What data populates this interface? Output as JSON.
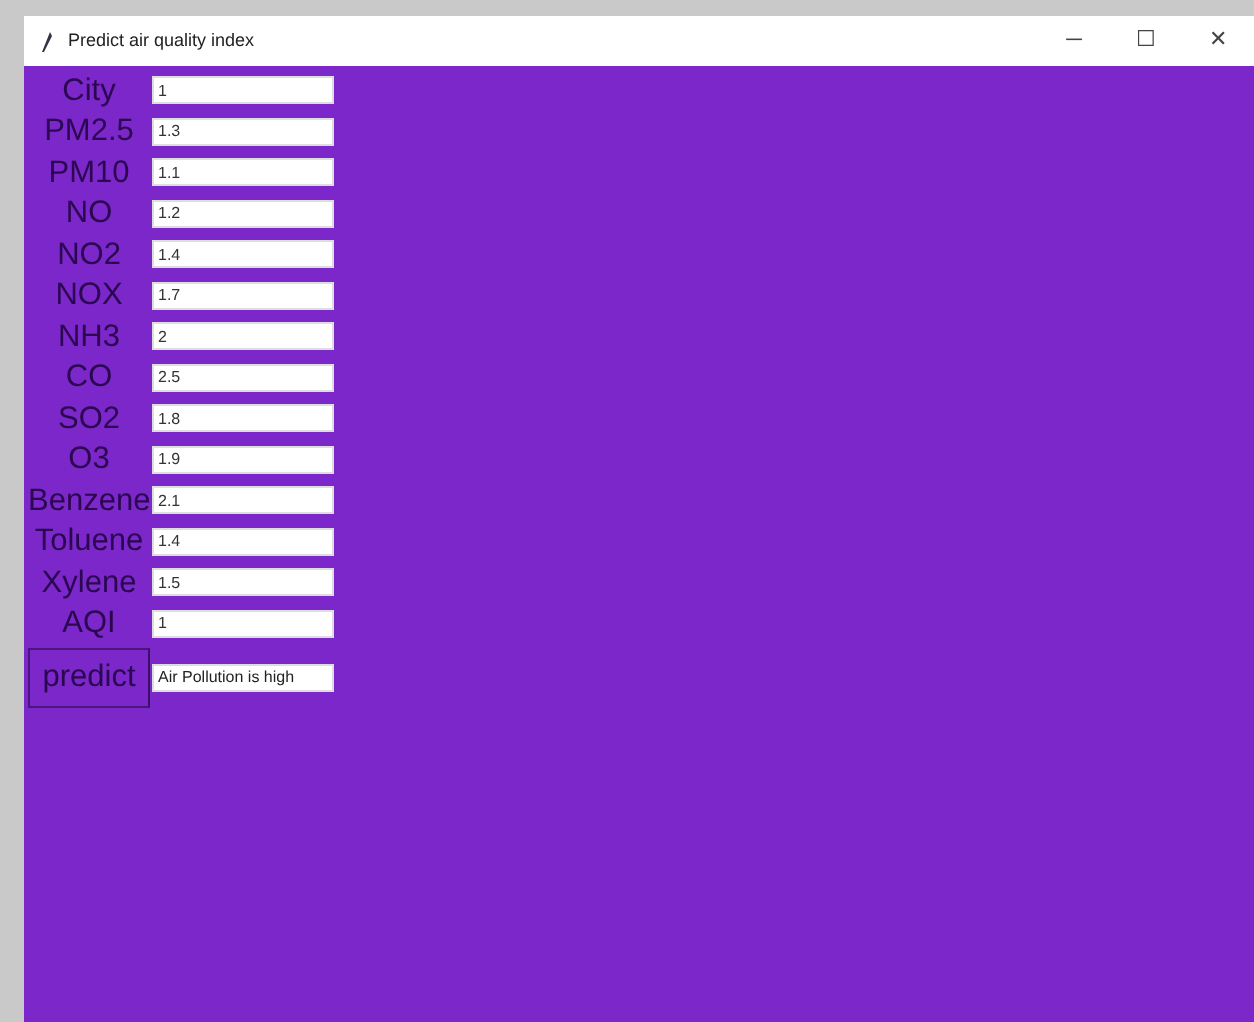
{
  "window": {
    "title": "Predict air quality index",
    "controls": [
      "─",
      "☐",
      "✕"
    ]
  },
  "fields": [
    {
      "label": "City",
      "value": "1"
    },
    {
      "label": "PM2.5",
      "value": "1.3"
    },
    {
      "label": "PM10",
      "value": "1.1"
    },
    {
      "label": "NO",
      "value": "1.2"
    },
    {
      "label": "NO2",
      "value": "1.4"
    },
    {
      "label": "NOX",
      "value": "1.7"
    },
    {
      "label": "NH3",
      "value": "2"
    },
    {
      "label": "CO",
      "value": "2.5"
    },
    {
      "label": "SO2",
      "value": "1.8"
    },
    {
      "label": "O3",
      "value": "1.9"
    },
    {
      "label": "Benzene",
      "value": "2.1"
    },
    {
      "label": "Toluene",
      "value": "1.4"
    },
    {
      "label": "Xylene",
      "value": "1.5"
    },
    {
      "label": "AQI",
      "value": "1"
    }
  ],
  "predict": {
    "button": "predict",
    "result": "Air Pollution is high"
  }
}
